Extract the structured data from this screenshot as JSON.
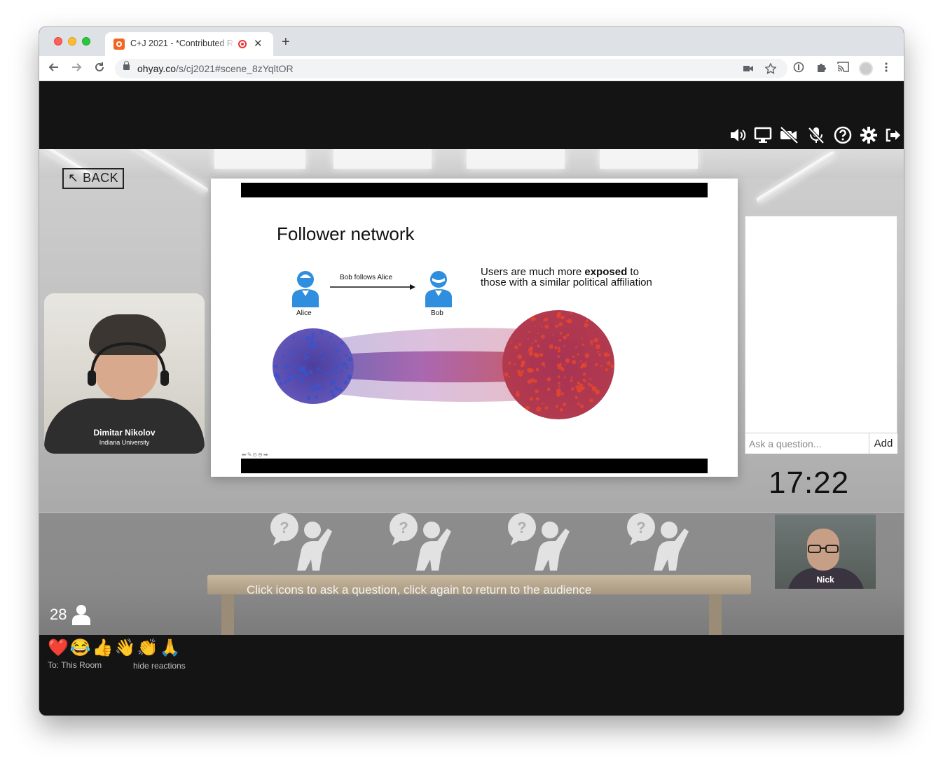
{
  "browser": {
    "tab_title": "C+J 2021 - *Contributed R",
    "tab_close": "✕",
    "new_tab": "+",
    "url_host": "ohyay.co",
    "url_path": "/s/cj2021#scene_8zYqltOR"
  },
  "toolbar_icons": [
    "volume-icon",
    "screen-share-icon",
    "camera-off-icon",
    "mic-off-icon",
    "help-icon",
    "settings-icon",
    "exit-icon"
  ],
  "room": {
    "back_label": "↖ BACK",
    "slide": {
      "title": "Follower network",
      "follow_label": "Bob follows Alice",
      "person_a": "Alice",
      "person_b": "Bob",
      "note_pre": "Users are much more ",
      "note_bold": "exposed",
      "note_post": " to those with a similar political affiliation",
      "controls": "⬅✎⊙⊖➡"
    },
    "speaker": {
      "name": "Dimitar Nikolov",
      "org": "Indiana University"
    },
    "qa": {
      "placeholder": "Ask a question...",
      "add_label": "Add"
    },
    "clock": "17:22",
    "attendee_video": {
      "name": "Nick"
    },
    "ask_hint": "Click icons to ask a question, click again to return to the audience",
    "attendee_count": "28"
  },
  "bottom": {
    "reactions": [
      "❤️",
      "😂",
      "👍",
      "👋",
      "👏",
      "🙏"
    ],
    "to_label": "To:  This Room",
    "hide_label": "hide reactions"
  },
  "colors": {
    "accent_blue": "#2f8fde",
    "network_blue": "#4a4fb0",
    "network_red": "#e0473a",
    "network_purple": "#8a3f9a"
  }
}
